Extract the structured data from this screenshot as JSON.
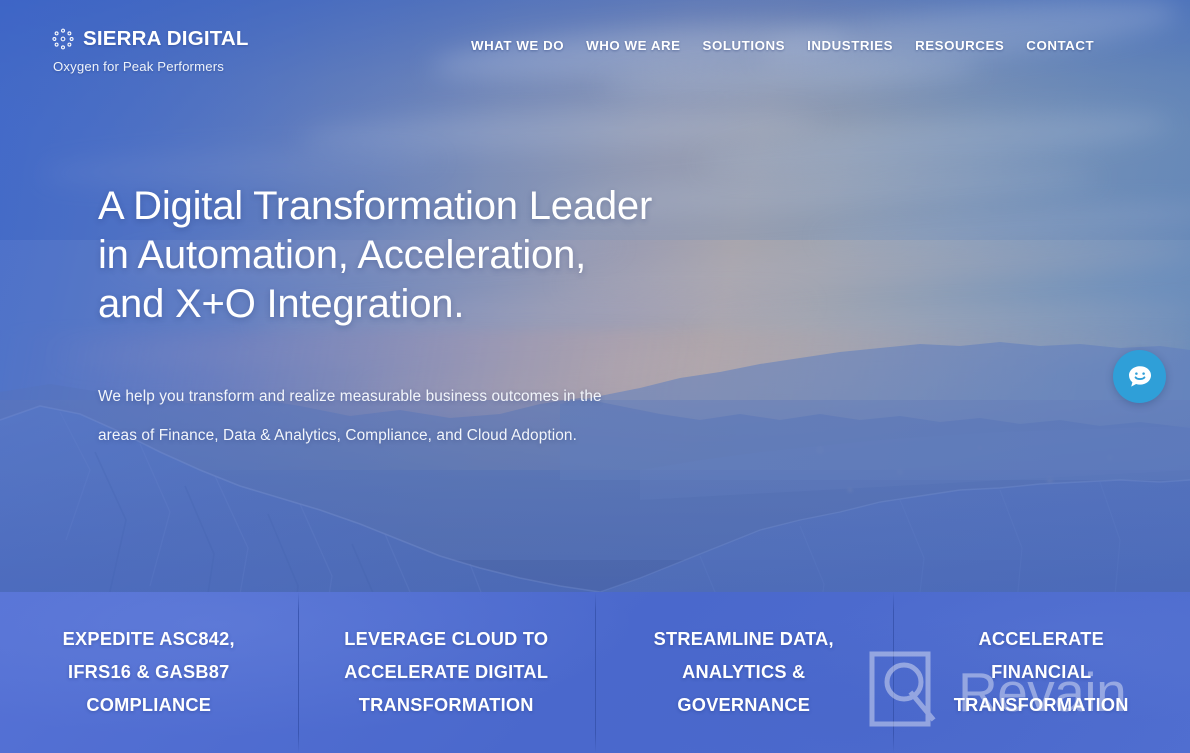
{
  "brand": {
    "name": "SIERRA DIGITAL",
    "tagline": "Oxygen for Peak Performers",
    "logo_icon": "molecule-dots-icon",
    "accent_color": "#4e6fcc"
  },
  "nav": {
    "items": [
      {
        "label": "WHAT WE DO"
      },
      {
        "label": "WHO WE ARE"
      },
      {
        "label": "SOLUTIONS"
      },
      {
        "label": "INDUSTRIES"
      },
      {
        "label": "RESOURCES"
      },
      {
        "label": "CONTACT"
      }
    ]
  },
  "hero": {
    "title_line1": "A Digital Transformation Leader",
    "title_line2": "in Automation, Acceleration,",
    "title_line3": "and X+O Integration.",
    "sub_line1": "We help you transform and realize measurable business outcomes in the",
    "sub_line2": "areas of Finance, Data & Analytics, Compliance, and Cloud Adoption."
  },
  "chat": {
    "icon": "chat-bubble-smiley-icon",
    "color": "#2f9fd8"
  },
  "cards": [
    {
      "line1": "EXPEDITE ASC842,",
      "line2": "IFRS16 & GASB87",
      "line3": "COMPLIANCE"
    },
    {
      "line1": "LEVERAGE CLOUD TO",
      "line2": "ACCELERATE DIGITAL",
      "line3": "TRANSFORMATION"
    },
    {
      "line1": "STREAMLINE DATA,",
      "line2": "ANALYTICS &",
      "line3": "GOVERNANCE"
    },
    {
      "line1": "ACCELERATE",
      "line2": "FINANCIAL",
      "line3": "TRANSFORMATION"
    }
  ],
  "watermark": {
    "text": "Revain",
    "icon": "revain-logo-icon"
  }
}
